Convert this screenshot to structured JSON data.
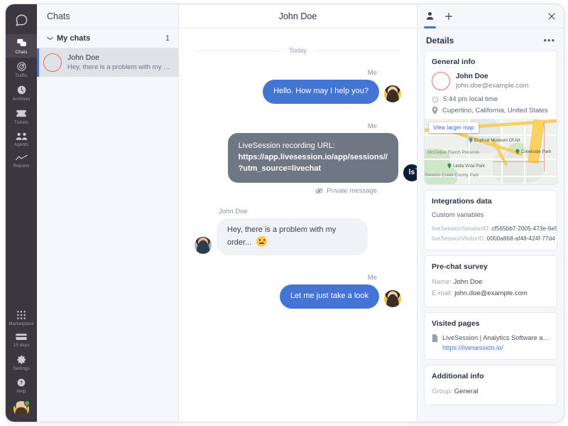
{
  "nav": {
    "logo_icon": "livechat-speech-bubble-logo",
    "items": [
      {
        "label": "Chats",
        "icon": "chats-icon",
        "active": true
      },
      {
        "label": "Traffic",
        "icon": "traffic-radar-icon",
        "active": false
      },
      {
        "label": "Archives",
        "icon": "archives-clock-icon",
        "active": false
      },
      {
        "label": "Tickets",
        "icon": "tickets-icon",
        "active": false
      },
      {
        "label": "Agents",
        "icon": "agents-people-icon",
        "active": false
      },
      {
        "label": "Reports",
        "icon": "reports-chart-icon",
        "active": false
      }
    ],
    "bottom_items": [
      {
        "label": "Marketplace",
        "icon": "marketplace-grid-icon"
      },
      {
        "label": "15 days",
        "icon": "trial-card-icon"
      },
      {
        "label": "Settings",
        "icon": "gear-icon"
      },
      {
        "label": "Help",
        "icon": "help-question-icon"
      }
    ],
    "avatar": {
      "name": "current-agent-avatar",
      "status": "online"
    }
  },
  "chatlist": {
    "title": "Chats",
    "section": {
      "label": "My chats",
      "count": "1",
      "chevron": "chevron-down-icon"
    },
    "items": [
      {
        "name": "John Doe",
        "preview": "Hey, there is a problem with my order...",
        "selected": true
      }
    ]
  },
  "conversation": {
    "title": "John Doe",
    "day_divider": "Today",
    "messages": [
      {
        "sender": "Me",
        "side": "out",
        "kind": "blue",
        "text": "Hello. How may I help you?",
        "avatar": "agent-avatar"
      },
      {
        "sender": "Me",
        "side": "out",
        "kind": "private",
        "lead": "LiveSession recording URL:",
        "url_line1": "https://app.livesession.io/app/sessions//",
        "url_line2": "?utm_source=livechat",
        "avatar": "livesession-logo-avatar",
        "avatar_text": "ls",
        "footnote": "Private message",
        "footnote_icon": "eye-off-icon"
      },
      {
        "sender": "John Doe",
        "side": "in",
        "kind": "grey",
        "text": "Hey, there is a problem with my order...",
        "emoji": "confused-face-emoji",
        "avatar": "john-doe-avatar"
      },
      {
        "sender": "Me",
        "side": "out",
        "kind": "blue",
        "text": "Let me just take a look",
        "avatar": "agent-avatar"
      }
    ]
  },
  "details": {
    "tabs": [
      {
        "icon": "person-icon",
        "active": true
      },
      {
        "icon": "plus-icon",
        "active": false
      }
    ],
    "close_icon": "close-icon",
    "header": {
      "title": "Details",
      "more_icon": "more-options-icon"
    },
    "general_info": {
      "heading": "General info",
      "name": "John Doe",
      "email": "john.doe@example.com",
      "local_time": "5:44 pm local time",
      "location": "Cupertino, California, United States",
      "time_icon": "clock-icon",
      "location_icon": "map-pin-icon",
      "map": {
        "button": "View larger map",
        "labels": [
          "Euphrat Museum Of Art",
          "Creekside Park",
          "McClellan Ranch Preserve",
          "Linda Vista Park",
          "Stevens Creek County Park"
        ]
      }
    },
    "integrations": {
      "heading": "Integrations data",
      "subheading": "Custom variables",
      "variables": [
        {
          "key": "liveSessionSessionID:",
          "value": "cf565bb7-2005-473e-6e5"
        },
        {
          "key": "liveSessionVisitorID:",
          "value": "0000a868-af48-424f-77d4"
        }
      ]
    },
    "prechat": {
      "heading": "Pre-chat survey",
      "rows": [
        {
          "key": "Name:",
          "value": "John Doe"
        },
        {
          "key": "E-mail:",
          "value": "john.doe@example.com"
        }
      ]
    },
    "visited_pages": {
      "heading": "Visited pages",
      "page_icon": "document-icon",
      "title": "LiveSession | Analytics Software and Ses...",
      "url": "https://livesession.io/"
    },
    "additional": {
      "heading": "Additional info",
      "row": {
        "key": "Group:",
        "value": "General"
      }
    }
  },
  "colors": {
    "accent_blue": "#4575d4",
    "nav_dark": "#3b3740",
    "private_grey": "#6f7684",
    "panel_bg": "#f5f7fa",
    "link_blue": "#4575d4"
  }
}
